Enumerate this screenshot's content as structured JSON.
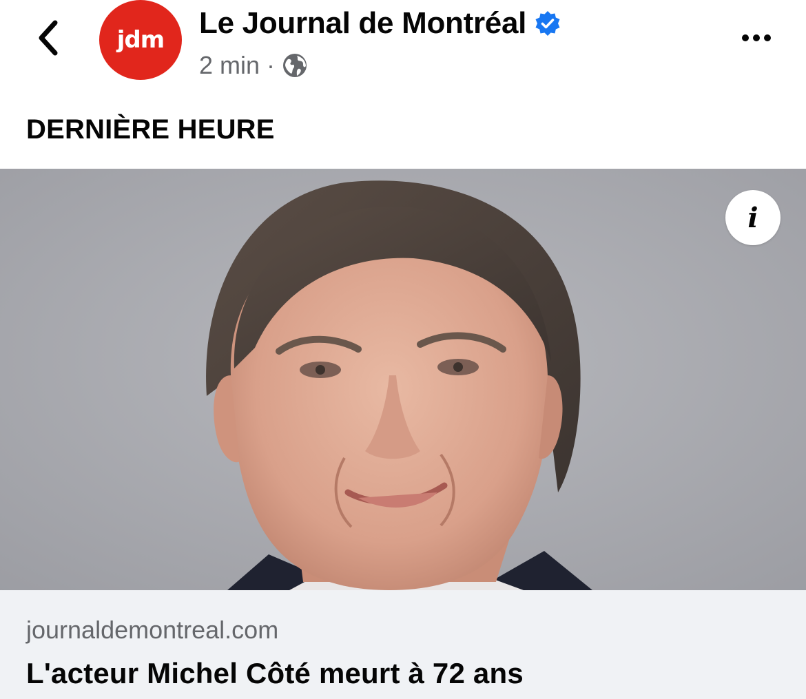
{
  "header": {
    "back_icon": "chevron-left-icon",
    "avatar_text": "jdm",
    "avatar_color": "#e1261c",
    "page_name": "Le Journal de Montréal",
    "verified_icon": "verified-badge-icon",
    "verified_color": "#1877f2",
    "time": "2 min",
    "separator": "·",
    "audience_icon": "globe-icon",
    "more_icon": "more-options-icon"
  },
  "post": {
    "text": "DERNIÈRE HEURE"
  },
  "image": {
    "info_label": "i",
    "info_icon": "info-icon"
  },
  "link": {
    "domain": "journaldemontreal.com",
    "title": "L'acteur Michel Côté meurt à 72 ans"
  }
}
